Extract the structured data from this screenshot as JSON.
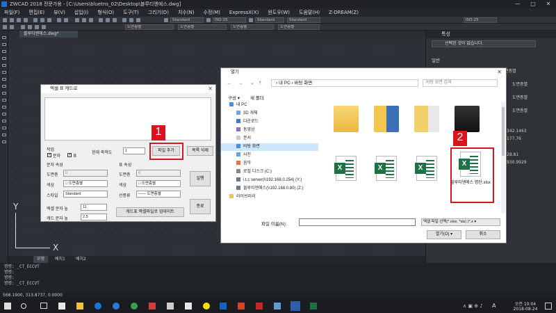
{
  "app": {
    "title": "ZWCAD 2018 전문가용 - [C:\\Users\\bluetns_02\\Desktop\\블루티엔에스.dwg]",
    "window_controls": [
      "—",
      "□",
      "✕"
    ]
  },
  "menu": [
    "파일(F)",
    "편집(E)",
    "뷰(V)",
    "삽입(I)",
    "형식(O)",
    "도구(T)",
    "그리기(D)",
    "치수(N)",
    "수정(M)",
    "ExpressX(X)",
    "윈도우(W)",
    "도움말(H)",
    "Z-DREAM(Z)"
  ],
  "toolbar": {
    "combo1": "Standard",
    "combo2": "ISO-25",
    "combo3": "Standard",
    "combo4": "Standard",
    "combo5": "ISO-25",
    "layer_combo": "도면층별",
    "linetype_combo": "도면층별",
    "color_combo": "도면층별",
    "lineweight_combo": "도면층별"
  },
  "document_tab": "블루티엔에스.dwg*",
  "layout_tabs": [
    "모형",
    "배치1",
    "배치2"
  ],
  "command_lines": [
    "명령: _CT_ECCVT",
    "명령:",
    "명령:",
    "명령: _CT_ECCVT"
  ],
  "status_coords": "568.1900, 313.8737, 0.0000",
  "ucs": {
    "y": "Y",
    "x": "X"
  },
  "properties_panel": {
    "title": "특성",
    "selection": "선택된 것이 없습니다.",
    "section": "일반",
    "rows": [
      "■ 도면층별",
      "도면층별",
      "도면층별",
      "도면층별"
    ],
    "values": [
      "342.1463",
      "177.76",
      "28.81",
      "930.9929"
    ]
  },
  "excel_dialog": {
    "title": "엑셀 표 캐드로",
    "work_label": "작업",
    "text_chk": "문자",
    "table_chk": "표",
    "scale_label": "현재 축척도",
    "scale_value": "1",
    "add_file_btn": "파일 추가",
    "delete_list_btn": "목록 삭제",
    "text_props_label": "문자 속성",
    "table_props_label": "표 속성",
    "layer_label": "도면층",
    "layer_value": "0",
    "color_label": "색상",
    "color_value": "□ 도면층별",
    "style_label": "스타일",
    "style_value": "Standard",
    "linetype_label": "선종류",
    "linetype_value": "—— 도면층별",
    "t_layer_label": "도면층",
    "t_layer_value": "0",
    "t_color_label": "색상",
    "t_color_value": "□ 도면층별",
    "excel_height_label": "엑셀 문자 높",
    "excel_height_value": "11",
    "cad_height_label": "캐드 문자 높",
    "cad_height_value": "2.5",
    "run_btn": "실행",
    "exit_btn": "종료",
    "update_btn": "캐드표 엑셀파일로 업데이트",
    "close": "✕"
  },
  "open_dialog": {
    "title": "열기",
    "address": "› 내 PC › 바탕 화면",
    "search_placeholder": "바탕 화면 검색",
    "organize": "구성 ▾",
    "new_folder": "새 폴더",
    "nav": [
      "내 PC",
      "3D 개체",
      "다운로드",
      "동영상",
      "문서",
      "바탕 화면",
      "사진",
      "음악",
      "로컬 디스크 (C:)",
      "i.t.c server(\\\\192.168.0.254) (Y:)",
      "블루티엔에스(\\\\192.168.0.80) (Z:)",
      "라이브러리"
    ],
    "selected_nav": "바탕 화면",
    "excel_file": "블루티엔에스 명단.xlsx",
    "filename_label": "파일 이름(N):",
    "filetype": "엑셀 파일 선택(*.xlsx, *xls) (*.x ▾",
    "open_btn": "열기(O) ▾",
    "cancel_btn": "취소",
    "close": "✕"
  },
  "badges": {
    "one": "1",
    "two": "2"
  },
  "taskbar": {
    "clock_time": "오전 10:04",
    "clock_date": "2018-08-24",
    "ime": "A"
  },
  "colors": {
    "highlight_red": "#d8141e",
    "excel_green": "#1e7145",
    "accent_blue": "#1e6fd0"
  }
}
